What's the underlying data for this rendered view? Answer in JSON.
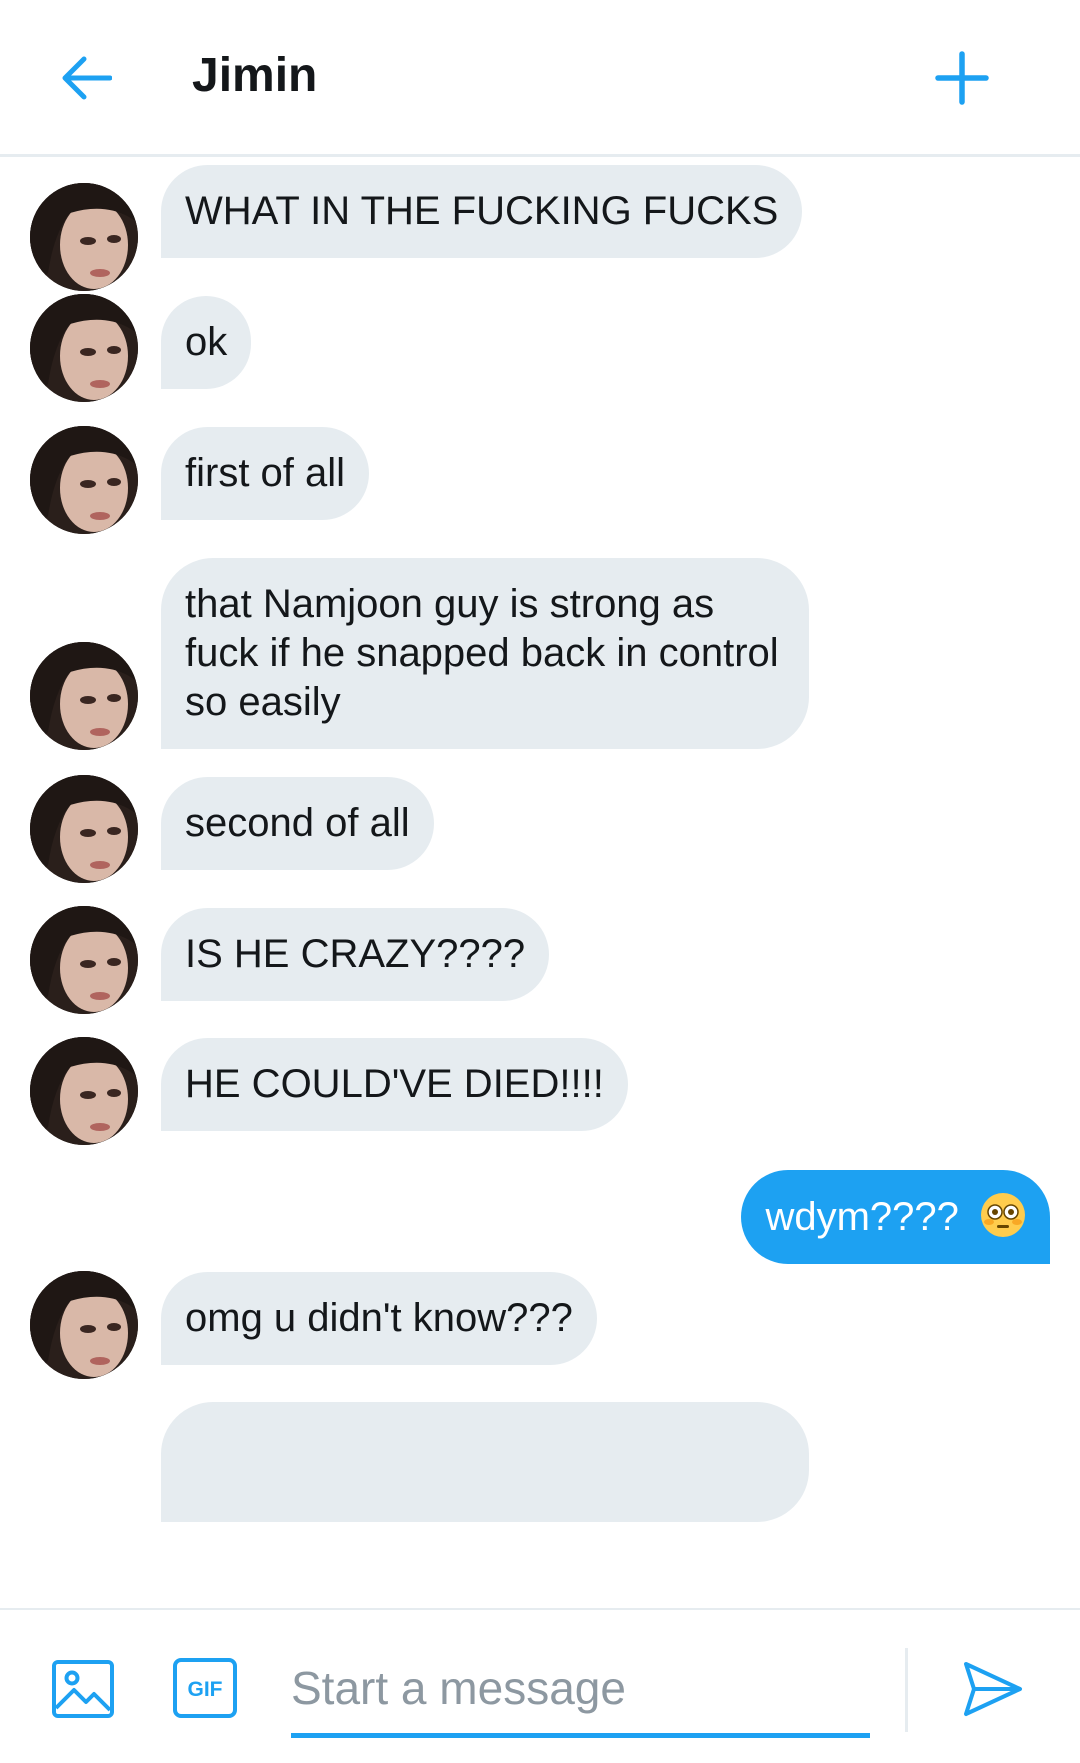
{
  "header": {
    "title": "Jimin",
    "back_icon": "arrow-left-icon",
    "new_icon": "plus-icon"
  },
  "colors": {
    "accent": "#1da1f2",
    "incoming_bubble": "#e6ecf0",
    "text": "#14171a",
    "placeholder": "#8d98a1",
    "divider": "#e6ecf0"
  },
  "messages": [
    {
      "direction": "incoming",
      "text": "WHAT IN THE FUCKING FUCKS"
    },
    {
      "direction": "incoming",
      "text": "ok"
    },
    {
      "direction": "incoming",
      "text": "first of all"
    },
    {
      "direction": "incoming",
      "text": "that Namjoon guy is strong as fuck if he snapped back in control so easily"
    },
    {
      "direction": "incoming",
      "text": "second of all"
    },
    {
      "direction": "incoming",
      "text": "IS HE CRAZY????"
    },
    {
      "direction": "incoming",
      "text": "HE COULD'VE DIED!!!!"
    },
    {
      "direction": "outgoing",
      "text": "wdym????",
      "emoji": "flushed-face-emoji"
    },
    {
      "direction": "incoming",
      "text": "omg u didn't know???"
    }
  ],
  "composer": {
    "placeholder": "Start a message",
    "value": "",
    "media_icon": "image-icon",
    "gif_label": "GIF",
    "send_icon": "send-icon"
  }
}
